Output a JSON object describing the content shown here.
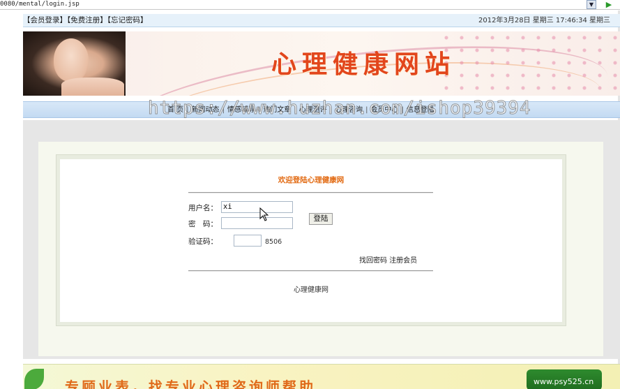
{
  "browser": {
    "url": "0080/mental/login.jsp",
    "dropdown_glyph": "▼",
    "go_glyph": "▶"
  },
  "memberbar": {
    "links": [
      "【会员登录】",
      "【免费注册】",
      "【忘记密码】"
    ],
    "datetime": "2012年3月28日 星期三 17:46:34 星期三"
  },
  "banner": {
    "title": "心理健康网站"
  },
  "nav": {
    "items": [
      "首 页",
      "新闻动态",
      "情感辅导",
      "热门文章",
      "心理测评",
      "心理咨询",
      "会员中心",
      "信息登陆"
    ],
    "separator": "|"
  },
  "watermark": "https://www.huzhan.com/ishop39394",
  "login": {
    "title": "欢迎登陆心理健康网",
    "username_label": "用户名：",
    "username_value": "xi",
    "password_label": "密　码：",
    "password_value": "",
    "captcha_label": "验证码：",
    "captcha_value": "",
    "captcha_code": "8506",
    "submit_label": "登陆",
    "forgot_label": "找回密码",
    "register_label": "注册会员",
    "footer": "心理健康网"
  },
  "ad": {
    "slogan": "专顾业表，找专业心理咨询师帮助",
    "site": "www.psy525.cn"
  },
  "colors": {
    "banner_title": "#e2461c",
    "login_title": "#e26a12",
    "nav_bg": "#c3daf2"
  }
}
